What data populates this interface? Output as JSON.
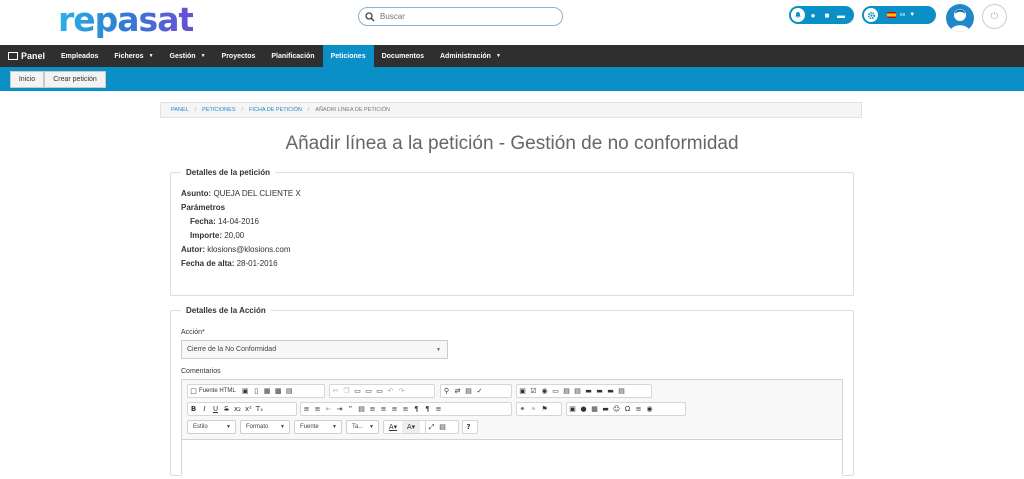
{
  "brand": {
    "logo_text": "repasat"
  },
  "search": {
    "placeholder": "Buscar"
  },
  "header": {
    "lang": "es"
  },
  "nav": {
    "panel": "Panel",
    "items": [
      {
        "label": "Empleados",
        "caret": false
      },
      {
        "label": "Ficheros",
        "caret": true
      },
      {
        "label": "Gestión",
        "caret": true
      },
      {
        "label": "Proyectos",
        "caret": false
      },
      {
        "label": "Planificación",
        "caret": false
      },
      {
        "label": "Peticiones",
        "caret": false,
        "active": true
      },
      {
        "label": "Documentos",
        "caret": false
      },
      {
        "label": "Administración",
        "caret": true
      }
    ]
  },
  "subbar": {
    "inicio": "Inicio",
    "crear": "Crear petición"
  },
  "breadcrumb": {
    "items": [
      "Panel",
      "Peticiones",
      "Ficha de petición"
    ],
    "current": "Añadir línea de petición"
  },
  "page_title": "Añadir línea a la petición - Gestión de no conformidad",
  "details": {
    "legend": "Detalles de la petición",
    "asunto_label": "Asunto:",
    "asunto": "QUEJA DEL CLIENTE X",
    "parametros_label": "Parámetros",
    "fecha_label": "Fecha:",
    "fecha": "14-04-2016",
    "importe_label": "Importe:",
    "importe": "20,00",
    "autor_label": "Autor:",
    "autor": "klosions@klosions.com",
    "alta_label": "Fecha de alta:",
    "alta": "28-01-2016"
  },
  "action": {
    "legend": "Detalles de la Acción",
    "accion_label": "Acción*",
    "accion_value": "Cierre de la No Conformidad",
    "comentarios_label": "Comentarios"
  },
  "editor": {
    "source_label": "Fuente HTML",
    "dd_estilo": "Estilo",
    "dd_formato": "Formato",
    "dd_fuente": "Fuente",
    "dd_size": "Ta...",
    "help": "?"
  },
  "colors": {
    "accent": "#0a8fc7",
    "navbar": "#2f2f2f"
  }
}
